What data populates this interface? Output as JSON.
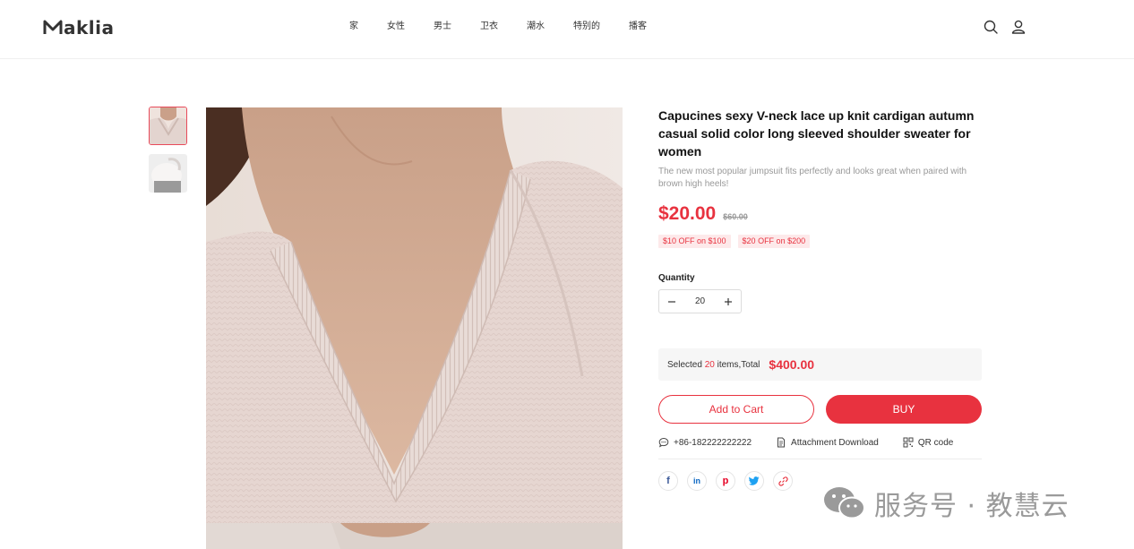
{
  "header": {
    "logo": "aklia",
    "nav": [
      "家",
      "女性",
      "男士",
      "卫衣",
      "潮水",
      "特别的",
      "播客"
    ]
  },
  "product": {
    "title": "Capucines sexy V-neck lace up knit cardigan autumn casual solid color long sleeved shoulder sweater for women",
    "subtitle": "The new most popular jumpsuit fits perfectly and looks great when paired with brown high heels!",
    "price": "$20.00",
    "old_price": "$60.00",
    "coupons": [
      "$10 OFF on $100",
      "$20 OFF on $200"
    ],
    "quantity_label": "Quantity",
    "quantity": "20",
    "summary": {
      "prefix": "Selected",
      "count": "20",
      "suffix": "items,Total",
      "total": "$400.00"
    },
    "add_to_cart": "Add to Cart",
    "buy": "BUY",
    "phone": "+86-182222222222",
    "attachment": "Attachment Download",
    "qr": "QR code"
  },
  "watermark": "服务号 · 教慧云",
  "colors": {
    "accent": "#e8323f"
  }
}
